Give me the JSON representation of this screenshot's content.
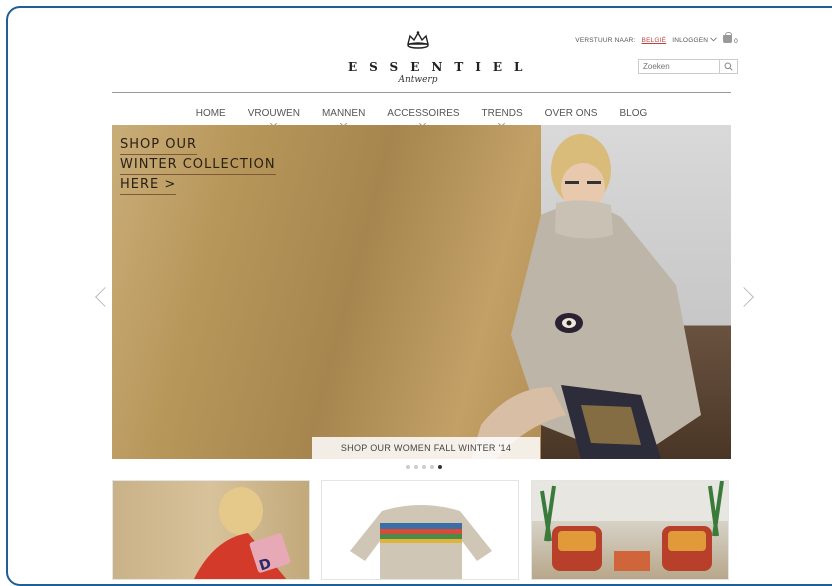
{
  "brand": {
    "name": "ESSENTIEL",
    "tagline": "Antwerp"
  },
  "utility": {
    "ship_to_label": "VERSTUUR NAAR:",
    "country": "BELGIË",
    "login": "INLOGGEN",
    "cart_count": "0"
  },
  "search": {
    "placeholder": "Zoeken"
  },
  "nav": {
    "items": [
      {
        "label": "HOME"
      },
      {
        "label": "VROUWEN"
      },
      {
        "label": "MANNEN"
      },
      {
        "label": "ACCESSOIRES"
      },
      {
        "label": "TRENDS"
      },
      {
        "label": "OVER ONS"
      },
      {
        "label": "BLOG"
      }
    ]
  },
  "hero": {
    "heading_lines": [
      "SHOP OUR",
      "WINTER COLLECTION",
      "HERE >"
    ],
    "cta": "SHOP OUR WOMEN FALL WINTER '14",
    "slide_count": 5,
    "active_slide": 5
  },
  "colors": {
    "frame_border": "#1f5f95",
    "hero_gold": "#b8975a",
    "country_link": "#b44444"
  }
}
